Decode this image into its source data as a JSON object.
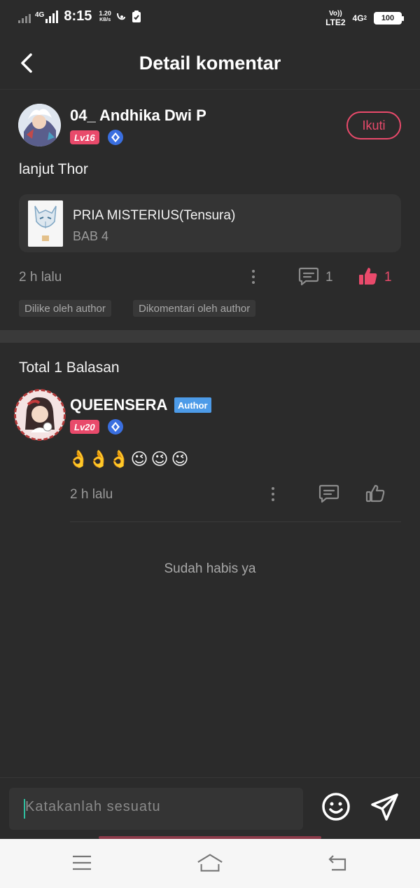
{
  "status_bar": {
    "network_1": "4G",
    "time": "8:15",
    "speed_value": "1.20",
    "speed_unit": "KB/s",
    "volte": "Vo))",
    "lte": "LTE2",
    "network_2": "4G",
    "network_2_sub": "2",
    "battery": "100"
  },
  "header": {
    "title": "Detail komentar"
  },
  "comment": {
    "username": "04_ Andhika Dwi P",
    "level": "Lv16",
    "follow_label": "Ikuti",
    "text": "lanjut Thor",
    "book": {
      "title": "PRIA MISTERIUS(Tensura)",
      "chapter": "BAB 4"
    },
    "time": "2 h lalu",
    "reply_count": "1",
    "like_count": "1",
    "tags": [
      "Dilike oleh author",
      "Dikomentari oleh author"
    ]
  },
  "replies": {
    "total_label": "Total 1 Balasan",
    "items": [
      {
        "username": "QUEENSERA",
        "author_badge": "Author",
        "level": "Lv20",
        "emojis": [
          "👌",
          "👌",
          "👌",
          "😉",
          "😉",
          "😉"
        ],
        "time": "2 h lalu"
      }
    ],
    "end_text": "Sudah habis ya"
  },
  "input": {
    "placeholder": "Katakanlah sesuatu"
  },
  "colors": {
    "background": "#2b2b2b",
    "accent": "#e94a6b",
    "author_badge": "#4d9be8",
    "vip_badge": "#3a6fe0"
  }
}
